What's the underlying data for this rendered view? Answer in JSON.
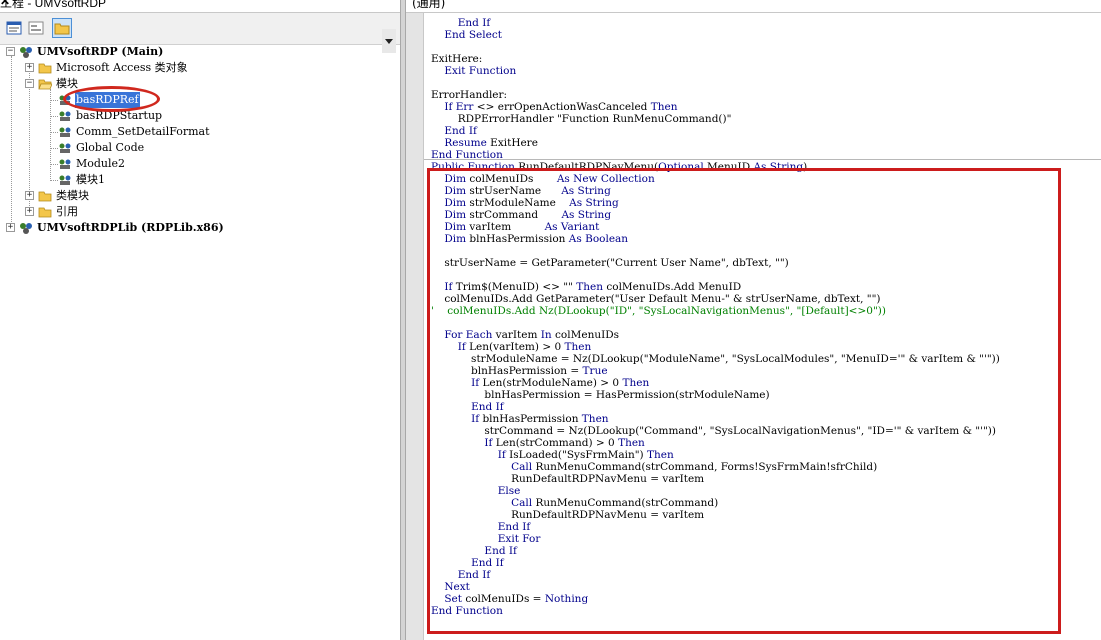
{
  "project_panel": {
    "title": "工程 - UMVsoftRDP",
    "close_glyph": "✕",
    "toolbar": {
      "view_code_icon": "view-code-icon",
      "view_object_icon": "view-object-icon",
      "toggle_folders_icon": "toggle-folders-icon"
    },
    "tree": [
      {
        "label": "UMVsoftRDP (Main)",
        "expander": "−",
        "icon": "vba-project-icon",
        "bold": true
      },
      {
        "label": "Microsoft Access 类对象",
        "expander": "+",
        "icon": "folder-icon"
      },
      {
        "label": "模块",
        "expander": "−",
        "icon": "open-folder-icon"
      },
      {
        "label": "basRDPRef",
        "icon": "module-icon",
        "selected": true
      },
      {
        "label": "basRDPStartup",
        "icon": "module-icon"
      },
      {
        "label": "Comm_SetDetailFormat",
        "icon": "module-icon"
      },
      {
        "label": "Global Code",
        "icon": "module-icon"
      },
      {
        "label": "Module2",
        "icon": "module-icon"
      },
      {
        "label": "模块1",
        "icon": "module-icon"
      },
      {
        "label": "类模块",
        "expander": "+",
        "icon": "folder-icon"
      },
      {
        "label": "引用",
        "expander": "+",
        "icon": "folder-icon"
      },
      {
        "label": "UMVsoftRDPLib (RDPLib.x86)",
        "expander": "+",
        "icon": "vba-project-icon",
        "bold": true
      }
    ]
  },
  "code_window": {
    "object_dropdown": "(通用)",
    "lines": [
      "        End If",
      "    End Select",
      "",
      "ExitHere:",
      "    Exit Function",
      "",
      "ErrorHandler:",
      "    If Err <> errOpenActionWasCanceled Then",
      "        RDPErrorHandler \"Function RunMenuCommand()\"",
      "    End If",
      "    Resume ExitHere",
      "End Function",
      "Public Function RunDefaultRDPNavMenu(Optional MenuID As String)",
      "    Dim colMenuIDs       As New Collection",
      "    Dim strUserName      As String",
      "    Dim strModuleName    As String",
      "    Dim strCommand       As String",
      "    Dim varItem          As Variant",
      "    Dim blnHasPermission As Boolean",
      "",
      "    strUserName = GetParameter(\"Current User Name\", dbText, \"\")",
      "",
      "    If Trim$(MenuID) <> \"\" Then colMenuIDs.Add MenuID",
      "    colMenuIDs.Add GetParameter(\"User Default Menu-\" & strUserName, dbText, \"\")",
      "'    colMenuIDs.Add Nz(DLookup(\"ID\", \"SysLocalNavigationMenus\", \"[Default]<>0\"))",
      "",
      "    For Each varItem In colMenuIDs",
      "        If Len(varItem) > 0 Then",
      "            strModuleName = Nz(DLookup(\"ModuleName\", \"SysLocalModules\", \"MenuID='\" & varItem & \"'\"))",
      "            blnHasPermission = True",
      "            If Len(strModuleName) > 0 Then",
      "                blnHasPermission = HasPermission(strModuleName)",
      "            End If",
      "            If blnHasPermission Then",
      "                strCommand = Nz(DLookup(\"Command\", \"SysLocalNavigationMenus\", \"ID='\" & varItem & \"'\"))",
      "                If Len(strCommand) > 0 Then",
      "                    If IsLoaded(\"SysFrmMain\") Then",
      "                        Call RunMenuCommand(strCommand, Forms!SysFrmMain!sfrChild)",
      "                        RunDefaultRDPNavMenu = varItem",
      "                    Else",
      "                        Call RunMenuCommand(strCommand)",
      "                        RunDefaultRDPNavMenu = varItem",
      "                    End If",
      "                    Exit For",
      "                End If",
      "            End If",
      "        End If",
      "    Next",
      "    Set colMenuIDs = Nothing",
      "End Function"
    ]
  }
}
